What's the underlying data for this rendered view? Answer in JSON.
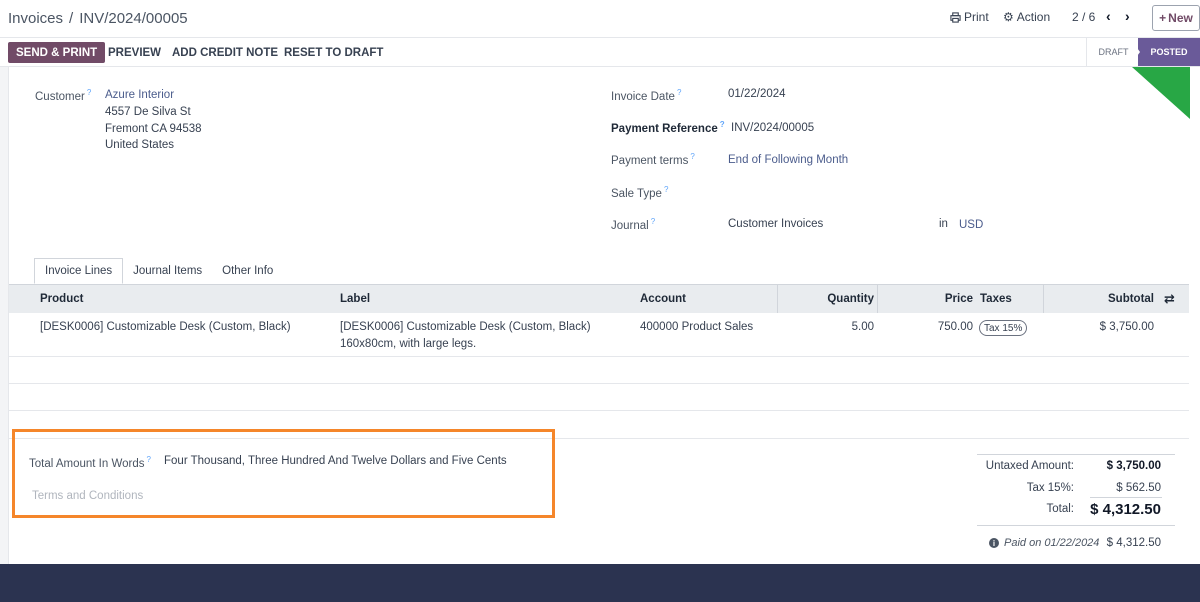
{
  "breadcrumb": {
    "parent": "Invoices",
    "separator": "/",
    "current": "INV/2024/00005"
  },
  "control_panel": {
    "print_label": "Print",
    "action_label": "Action",
    "pager": "2 / 6",
    "new_label": "New"
  },
  "statusbar": {
    "buttons": [
      "SEND & PRINT",
      "PREVIEW",
      "ADD CREDIT NOTE",
      "RESET TO DRAFT"
    ],
    "stages": [
      "DRAFT",
      "POSTED"
    ],
    "active_stage": "POSTED"
  },
  "customer": {
    "label": "Customer",
    "name": "Azure Interior",
    "street": "4557 De Silva St",
    "city": "Fremont CA 94538",
    "country": "United States"
  },
  "fields": {
    "invoice_date_label": "Invoice Date",
    "invoice_date": "01/22/2024",
    "payment_reference_label": "Payment Reference",
    "payment_reference": "INV/2024/00005",
    "payment_terms_label": "Payment terms",
    "payment_terms": "End of Following Month",
    "sale_type_label": "Sale Type",
    "journal_label": "Journal",
    "journal": "Customer Invoices",
    "currency_in": "in",
    "currency": "USD"
  },
  "tabs": [
    "Invoice Lines",
    "Journal Items",
    "Other Info"
  ],
  "table": {
    "columns": [
      "Product",
      "Label",
      "Account",
      "Quantity",
      "Price",
      "Taxes",
      "Subtotal"
    ],
    "rows": [
      {
        "product": "[DESK0006] Customizable Desk (Custom, Black)",
        "label_line1": "[DESK0006] Customizable Desk (Custom, Black)",
        "label_line2": "160x80cm, with large legs.",
        "account": "400000 Product Sales",
        "quantity": "5.00",
        "price": "750.00",
        "taxes": "Tax 15%",
        "subtotal": "$ 3,750.00"
      }
    ]
  },
  "notes": {
    "amount_words_label": "Total Amount In Words",
    "amount_words": "Four Thousand, Three Hundred And Twelve Dollars and Five Cents",
    "terms_placeholder": "Terms and Conditions"
  },
  "totals": {
    "untaxed_label": "Untaxed Amount:",
    "untaxed": "$ 3,750.00",
    "tax_label": "Tax 15%:",
    "tax": "$ 562.50",
    "total_label": "Total:",
    "total": "$ 4,312.50",
    "paid_label": "Paid on 01/22/2024",
    "paid_amount": "$ 4,312.50"
  },
  "colors": {
    "brand": "#714b67",
    "stage_active": "#6a5a99",
    "ribbon": "#28a745",
    "highlight": "#f5862a",
    "footer": "#2b3350"
  }
}
